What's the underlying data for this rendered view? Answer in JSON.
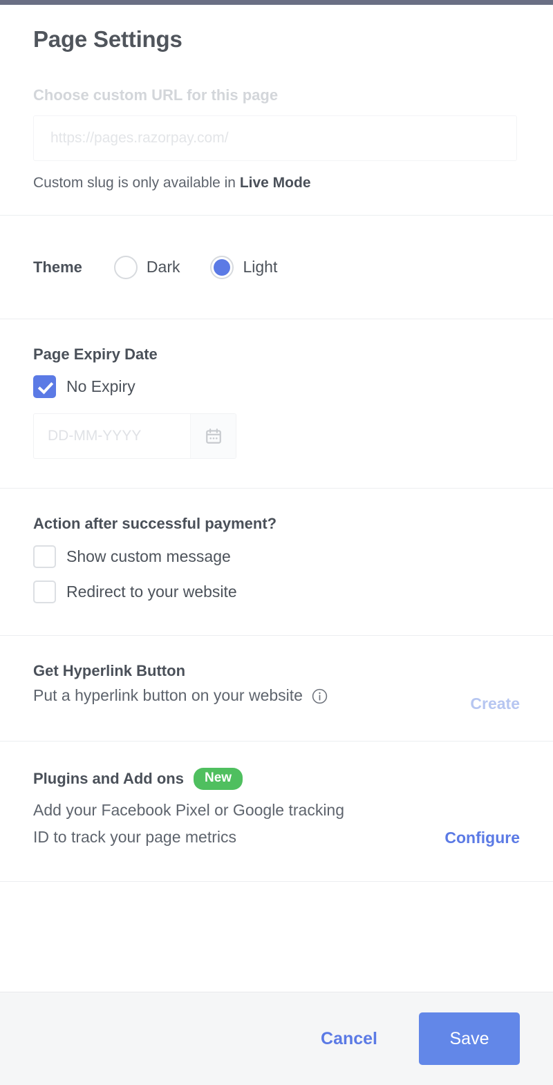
{
  "modal": {
    "title": "Page Settings",
    "accent_bar_color": "#6a6f84"
  },
  "url_section": {
    "label": "Choose custom URL for this page",
    "input_value": "",
    "input_placeholder": "https://pages.razorpay.com/",
    "hint_prefix": "Custom slug is only available in ",
    "hint_emphasis": "Live Mode"
  },
  "theme_section": {
    "label": "Theme",
    "options": [
      {
        "label": "Dark",
        "selected": false
      },
      {
        "label": "Light",
        "selected": true
      }
    ],
    "selected_value": "Light",
    "selected_color": "#5b7ae5"
  },
  "expiry_section": {
    "heading": "Page Expiry Date",
    "no_expiry_label": "No Expiry",
    "no_expiry_checked": true,
    "date_value": "",
    "date_placeholder": "DD-MM-YYYY",
    "calendar_icon": "calendar-icon"
  },
  "action_section": {
    "heading": "Action after successful payment?",
    "options": [
      {
        "label": "Show custom message",
        "checked": false
      },
      {
        "label": "Redirect to your website",
        "checked": false
      }
    ]
  },
  "hyperlink_section": {
    "heading": "Get Hyperlink Button",
    "description": "Put a hyperlink button on your website",
    "info_icon": "info-icon",
    "action_label": "Create",
    "action_color": "#b6c6f1"
  },
  "plugins_section": {
    "heading": "Plugins and Add ons",
    "badge": "New",
    "badge_color": "#4fbf5f",
    "description": "Add your Facebook Pixel or Google tracking ID to track your page metrics",
    "action_label": "Configure",
    "action_color": "#5b7ae5"
  },
  "footer": {
    "cancel_label": "Cancel",
    "save_label": "Save",
    "save_color": "#6287e8"
  }
}
